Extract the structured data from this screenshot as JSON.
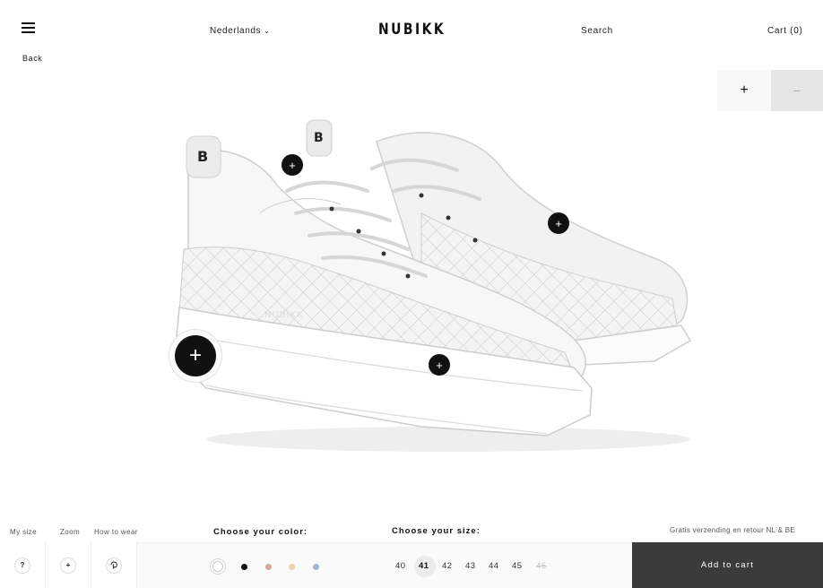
{
  "header": {
    "menu_icon": "hamburger-icon",
    "back_label": "Back",
    "language": "Nederlands",
    "language_icon": "chevron-down-icon",
    "logo": "NUBIKK",
    "search_label": "Search",
    "cart_label": "Cart (0)"
  },
  "zoom_controls": {
    "zoom_in_label": "+",
    "zoom_out_label": "−"
  },
  "hotspots": {
    "icon": "plus-icon",
    "label": "+"
  },
  "tools": {
    "my_size_label": "My size",
    "my_size_icon": "?",
    "zoom_label": "Zoom",
    "zoom_icon": "+",
    "how_to_wear_label": "How to wear",
    "how_to_wear_icon": "pinterest-icon"
  },
  "colors": {
    "title": "Choose your color:",
    "swatches": [
      "#ffffff",
      "#111111",
      "#d9a9a0",
      "#e8d5a8",
      "#a5b6cc"
    ],
    "selected_index": 0
  },
  "sizes": {
    "title": "Choose your size:",
    "options": [
      "40",
      "41",
      "42",
      "43",
      "44",
      "45",
      "46"
    ],
    "selected": "41",
    "sold_out": "46"
  },
  "shipping_note": "Gratis verzending en retour NL & BE",
  "cart": {
    "add_label": "Add to cart"
  }
}
